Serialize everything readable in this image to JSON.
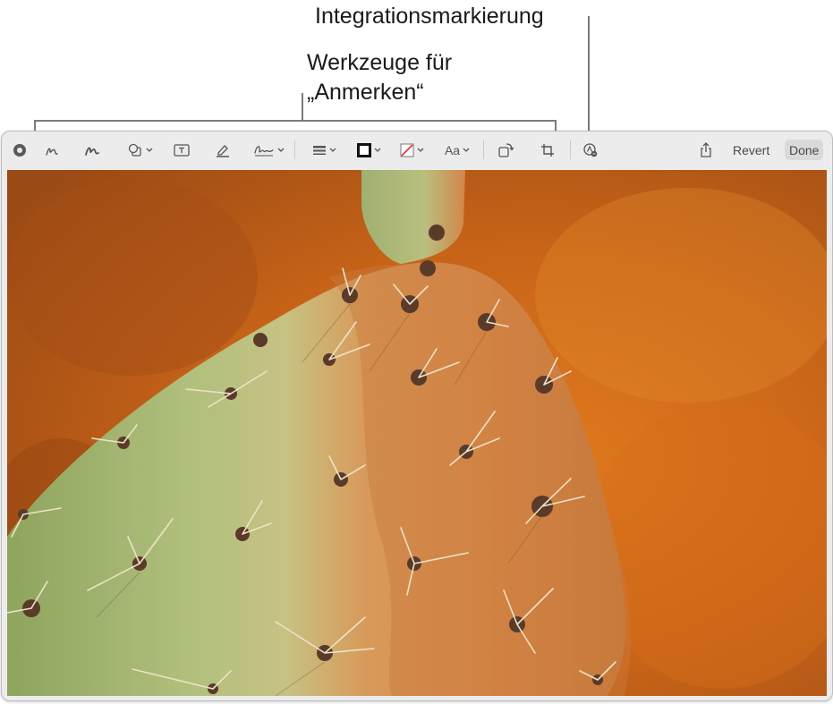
{
  "callouts": {
    "integration_label": "Integrationsmarkierung",
    "tools_label_line1": "Werkzeuge für",
    "tools_label_line2": "„Anmerken“"
  },
  "toolbar": {
    "revert_label": "Revert",
    "done_label": "Done",
    "text_style_label": "Aa",
    "tools": [
      "record-icon",
      "sketch-icon",
      "draw-icon",
      "shapes-icon",
      "text-box-icon",
      "highlight-icon",
      "sign-icon",
      "line-style-icon",
      "border-color-icon",
      "fill-color-icon",
      "text-style-icon",
      "rotate-icon",
      "crop-icon",
      "markup-extension-icon",
      "share-icon"
    ]
  },
  "photo": {
    "subject": "prickly pear cactus pad with spines on orange background"
  },
  "colors": {
    "background_orange": "#c9661c",
    "cactus_green": "#a9b874",
    "toolbar_bg": "#ececec",
    "callout_line": "#7b7b7b"
  }
}
